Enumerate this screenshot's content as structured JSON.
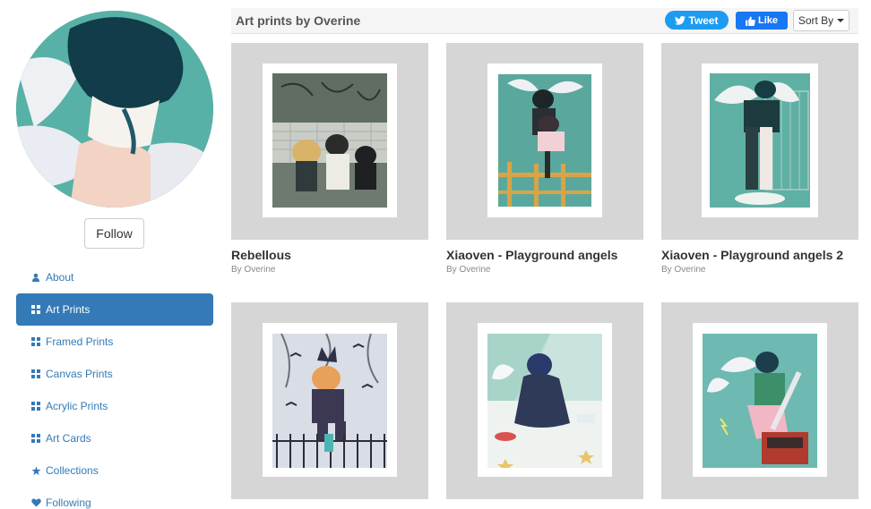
{
  "profile": {
    "follow_label": "Follow"
  },
  "nav": {
    "items": [
      {
        "label": "About",
        "icon": "user-icon"
      },
      {
        "label": "Art Prints",
        "icon": "grid-icon",
        "active": true
      },
      {
        "label": "Framed Prints",
        "icon": "grid-icon"
      },
      {
        "label": "Canvas Prints",
        "icon": "grid-icon"
      },
      {
        "label": "Acrylic Prints",
        "icon": "grid-icon"
      },
      {
        "label": "Art Cards",
        "icon": "grid-icon"
      },
      {
        "label": "Collections",
        "icon": "star-icon"
      },
      {
        "label": "Following",
        "icon": "heart-icon"
      }
    ]
  },
  "header": {
    "title": "Art prints by Overine",
    "tweet_label": "Tweet",
    "like_label": "Like",
    "sort_label": "Sort By"
  },
  "cards": [
    {
      "title": "Rebellous",
      "byline": "By Overine"
    },
    {
      "title": "Xiaoven - Playground angels",
      "byline": "By Overine"
    },
    {
      "title": "Xiaoven - Playground angels 2",
      "byline": "By Overine"
    },
    {
      "title": "",
      "byline": ""
    },
    {
      "title": "",
      "byline": ""
    },
    {
      "title": "",
      "byline": ""
    }
  ],
  "colors": {
    "accent": "#337ab7",
    "twitter": "#1d9bf0",
    "facebook": "#1877f2",
    "card_bg": "#d6d6d6"
  }
}
